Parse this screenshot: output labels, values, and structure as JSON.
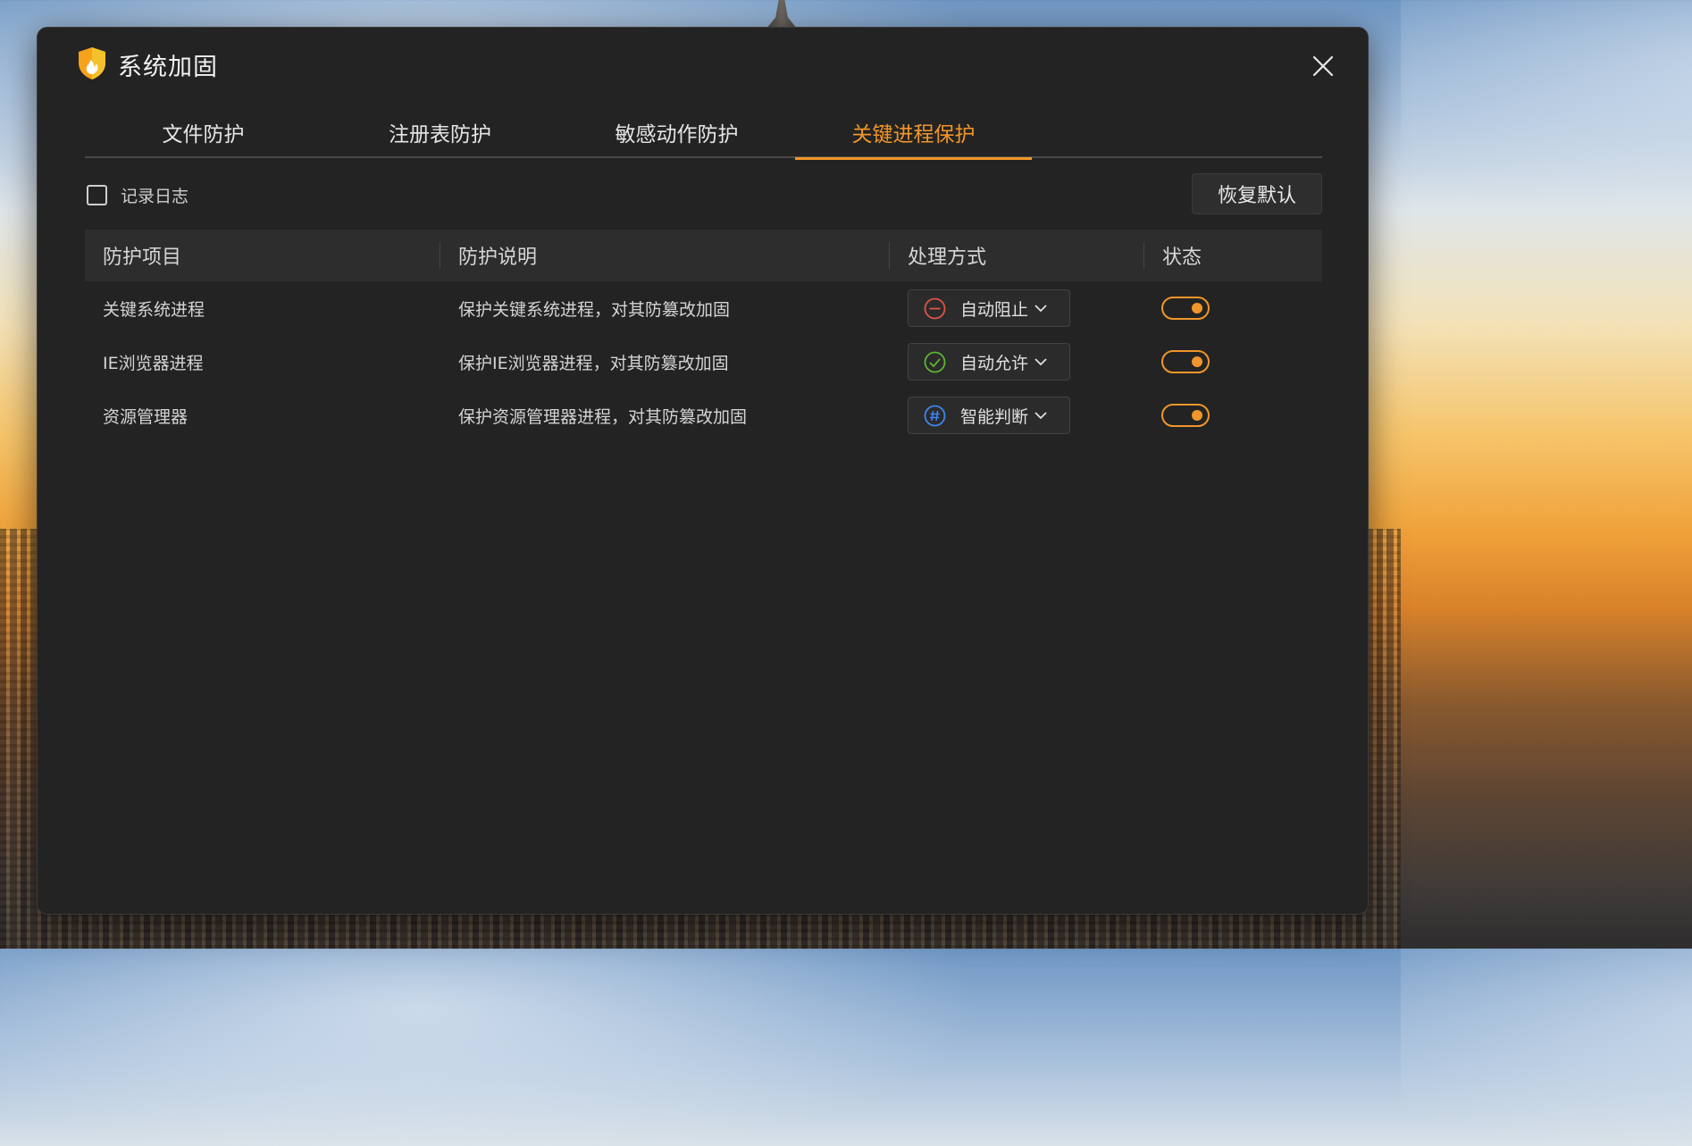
{
  "window": {
    "title": "系统加固",
    "icon": "shield-flame-icon",
    "close_icon": "close-icon"
  },
  "tabs": [
    {
      "label": "文件防护",
      "active": false
    },
    {
      "label": "注册表防护",
      "active": false
    },
    {
      "label": "敏感动作防护",
      "active": false
    },
    {
      "label": "关键进程保护",
      "active": true
    }
  ],
  "toolbar": {
    "log_label": "记录日志",
    "log_checked": false,
    "restore_label": "恢复默认"
  },
  "table": {
    "columns": [
      "防护项目",
      "防护说明",
      "处理方式",
      "状态"
    ],
    "rows": [
      {
        "item": "关键系统进程",
        "desc": "保护关键系统进程，对其防篡改加固",
        "action": "自动阻止",
        "action_icon": "block-icon",
        "action_color": "#e0534a",
        "enabled": true
      },
      {
        "item": "IE浏览器进程",
        "desc": "保护IE浏览器进程，对其防篡改加固",
        "action": "自动允许",
        "action_icon": "check-circle-icon",
        "action_color": "#5cb531",
        "enabled": true
      },
      {
        "item": "资源管理器",
        "desc": "保护资源管理器进程，对其防篡改加固",
        "action": "智能判断",
        "action_icon": "hash-circle-icon",
        "action_color": "#3d86f0",
        "enabled": true
      }
    ]
  },
  "colors": {
    "accent": "#f0962a",
    "window_bg": "#232323",
    "header_bg": "#2d2d2d"
  }
}
